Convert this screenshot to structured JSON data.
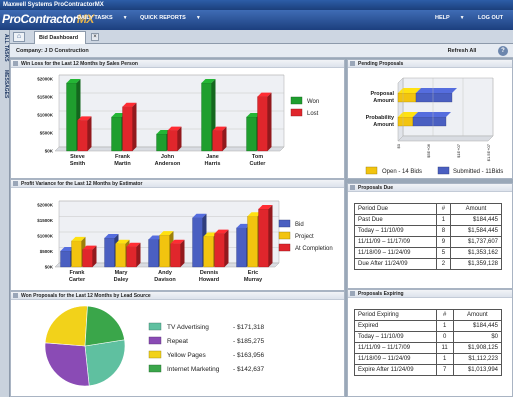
{
  "window": {
    "title": "Maxwell Systems ProContractorMX"
  },
  "app": {
    "logo_main": "ProContractor",
    "logo_suffix": "MX",
    "nav": {
      "daily_tasks": "DAILY TASKS",
      "quick_reports": "QUICK REPORTS",
      "help": "HELP",
      "logout": "LOG OUT"
    }
  },
  "sidebar": {
    "all_tasks": "ALL TASKS",
    "messages": "MESSAGES"
  },
  "tabs": {
    "home_glyph": "⌂",
    "active": "Bid Dashboard",
    "close_glyph": "×"
  },
  "toolbar": {
    "company": "Company: J D Construction",
    "refresh": "Refresh All",
    "help_glyph": "?"
  },
  "panels": {
    "win_loss": {
      "title": "Win Loss for the Last 12 Months by Sales Person"
    },
    "pending": {
      "title": "Pending Proposals"
    },
    "profit_variance": {
      "title": "Profit Variance for the Last 12 Months by Estimator"
    },
    "proposals_due": {
      "title": "Proposals Due"
    },
    "won_proposals": {
      "title": "Won Proposals for the Last 12 Months by Lead Source"
    },
    "proposals_expiring": {
      "title": "Proposals Expiring"
    }
  },
  "proposals_due_table": {
    "headers": [
      "Period Due",
      "#",
      "Amount"
    ],
    "rows": [
      [
        "Past Due",
        "1",
        "$184,445"
      ],
      [
        "Today – 11/10/09",
        "8",
        "$1,584,445"
      ],
      [
        "11/11/09 – 11/17/09",
        "9",
        "$1,737,607"
      ],
      [
        "11/18/09 – 11/24/09",
        "5",
        "$1,353,162"
      ],
      [
        "Due After 11/24/09",
        "2",
        "$1,359,128"
      ]
    ]
  },
  "proposals_expiring_table": {
    "headers": [
      "Period Expiring",
      "#",
      "Amount"
    ],
    "rows": [
      [
        "Expired",
        "1",
        "$184,445"
      ],
      [
        "Today – 11/10/09",
        "0",
        "$0"
      ],
      [
        "11/11/09 – 11/17/09",
        "11",
        "$1,908,125"
      ],
      [
        "11/18/09 – 11/24/09",
        "1",
        "$1,112,223"
      ],
      [
        "Expire After 11/24/09",
        "7",
        "$1,013,994"
      ]
    ]
  },
  "colors": {
    "won": "#1f9e2e",
    "lost": "#e0262c",
    "bid": "#4a5fc1",
    "project": "#f2c40f",
    "at_completion": "#e0262c",
    "open": "#f2c40f",
    "submitted": "#4a5fc1"
  },
  "chart_data": [
    {
      "type": "bar",
      "categories": [
        "Steve Smith",
        "Frank Martin",
        "John Anderson",
        "Jane Harris",
        "Tom Cutler"
      ],
      "series": [
        {
          "name": "Won",
          "values": [
            2000,
            1000,
            500,
            2000,
            1000
          ]
        },
        {
          "name": "Lost",
          "values": [
            900,
            1300,
            600,
            600,
            1600
          ]
        }
      ],
      "yticks": [
        "$0K",
        "$500K",
        "$1000K",
        "$1500K",
        "$2000K"
      ],
      "ylim": [
        0,
        2000
      ],
      "legend": "right"
    },
    {
      "type": "bar",
      "categories": [
        "Frank Carter",
        "Mary Daley",
        "Andy Davison",
        "Dennis Howard",
        "Eric Murray"
      ],
      "series": [
        {
          "name": "Bid",
          "values": [
            550,
            1000,
            950,
            1700,
            1350
          ]
        },
        {
          "name": "Project",
          "values": [
            900,
            800,
            1100,
            1050,
            1750
          ]
        },
        {
          "name": "At Completion",
          "values": [
            600,
            700,
            800,
            1150,
            2000
          ]
        }
      ],
      "yticks": [
        "$0K",
        "$500K",
        "$1000K",
        "$1500K",
        "$2000K"
      ],
      "ylim": [
        0,
        2000
      ],
      "legend": "right"
    },
    {
      "type": "bar",
      "orientation": "horizontal",
      "stacked": true,
      "categories": [
        "Proposal Amount",
        "Probability Amount"
      ],
      "series": [
        {
          "name": "Open - 14 Bids",
          "values": [
            300000,
            250000
          ]
        },
        {
          "name": "Submitted - 11Bids",
          "values": [
            600000,
            550000
          ]
        }
      ],
      "xticks": [
        "$0",
        "$5E+06",
        "$1E+07",
        "$1.5E+07"
      ],
      "xlim": [
        0,
        1500000
      ],
      "legend": "bottom"
    },
    {
      "type": "pie",
      "categories": [
        "TV Advertising",
        "Repeat",
        "Yellow Pages",
        "Internet Marketing"
      ],
      "values": [
        171318,
        185275,
        163956,
        142637
      ],
      "labels": [
        "- $171,318",
        "- $185,275",
        "- $163,956",
        "- $142,637"
      ],
      "legend": "right"
    }
  ]
}
